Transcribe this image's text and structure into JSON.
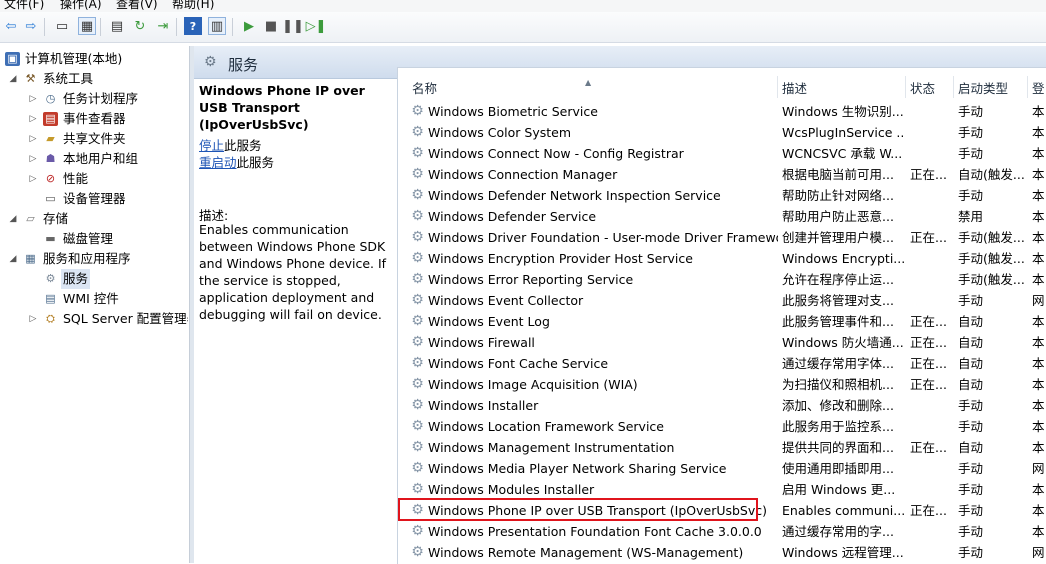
{
  "menu": [
    "文件(F)",
    "操作(A)",
    "查看(V)",
    "帮助(H)"
  ],
  "toolbar": [
    {
      "icon": "back-arrow-icon",
      "glyph": "⇦"
    },
    {
      "icon": "forward-arrow-icon",
      "glyph": "⇨"
    },
    {
      "icon": "up-folder-icon",
      "glyph": "▭"
    },
    {
      "icon": "show-hide-tree-icon",
      "glyph": "▦"
    },
    {
      "icon": "properties-icon",
      "glyph": "▤"
    },
    {
      "icon": "refresh-icon",
      "glyph": "↻"
    },
    {
      "icon": "export-list-icon",
      "glyph": "⇥"
    },
    {
      "icon": "help-icon",
      "glyph": "?"
    },
    {
      "icon": "show-action-pane-icon",
      "glyph": "▥"
    },
    {
      "icon": "start-service-icon",
      "glyph": "▶"
    },
    {
      "icon": "stop-service-icon",
      "glyph": "■"
    },
    {
      "icon": "pause-service-icon",
      "glyph": "❚❚"
    },
    {
      "icon": "restart-service-icon",
      "glyph": "▷❚"
    }
  ],
  "tree": [
    {
      "label": "计算机管理(本地)",
      "icon": "computer-management-icon",
      "glyph": "▣",
      "level": 0,
      "expander": "",
      "selected": false
    },
    {
      "label": "系统工具",
      "icon": "system-tools-icon",
      "glyph": "⚒",
      "level": 1,
      "expander": "◢",
      "selected": false
    },
    {
      "label": "任务计划程序",
      "icon": "task-scheduler-icon",
      "glyph": "◷",
      "level": 2,
      "expander": "▷",
      "selected": false
    },
    {
      "label": "事件查看器",
      "icon": "event-viewer-icon",
      "glyph": "▤",
      "level": 2,
      "expander": "▷",
      "selected": false
    },
    {
      "label": "共享文件夹",
      "icon": "shared-folders-icon",
      "glyph": "▰",
      "level": 2,
      "expander": "▷",
      "selected": false
    },
    {
      "label": "本地用户和组",
      "icon": "local-users-groups-icon",
      "glyph": "☗",
      "level": 2,
      "expander": "▷",
      "selected": false
    },
    {
      "label": "性能",
      "icon": "performance-icon",
      "glyph": "⊘",
      "level": 2,
      "expander": "▷",
      "selected": false
    },
    {
      "label": "设备管理器",
      "icon": "device-manager-icon",
      "glyph": "▭",
      "level": 2,
      "expander": "",
      "selected": false
    },
    {
      "label": "存储",
      "icon": "storage-icon",
      "glyph": "▱",
      "level": 1,
      "expander": "◢",
      "selected": false
    },
    {
      "label": "磁盘管理",
      "icon": "disk-management-icon",
      "glyph": "▬",
      "level": 2,
      "expander": "",
      "selected": false
    },
    {
      "label": "服务和应用程序",
      "icon": "services-applications-icon",
      "glyph": "▦",
      "level": 1,
      "expander": "◢",
      "selected": false
    },
    {
      "label": "服务",
      "icon": "services-gear-icon",
      "glyph": "⚙",
      "level": 2,
      "expander": "",
      "selected": true
    },
    {
      "label": "WMI 控件",
      "icon": "wmi-control-icon",
      "glyph": "▤",
      "level": 2,
      "expander": "",
      "selected": false
    },
    {
      "label": "SQL Server 配置管理器",
      "icon": "sql-server-config-icon",
      "glyph": "⛭",
      "level": 2,
      "expander": "▷",
      "selected": false
    }
  ],
  "header": {
    "title": "服务",
    "icon": "services-header-icon",
    "glyph": "⚙"
  },
  "description": {
    "title": "Windows Phone IP over USB Transport (IpOverUsbSvc)",
    "stop_link": "停止",
    "stop_suffix": "此服务",
    "restart_link": "重启动",
    "restart_suffix": "此服务",
    "desc_label": "描述:",
    "desc_text": "Enables communication between Windows Phone SDK and Windows Phone device. If the service is stopped, application deployment and debugging will fail on device."
  },
  "columns": [
    "名称",
    "描述",
    "状态",
    "启动类型",
    "登"
  ],
  "rows": [
    [
      "Windows Biometric Service",
      "Windows 生物识别...",
      "",
      "手动",
      "本"
    ],
    [
      "Windows Color System",
      "WcsPlugInService ...",
      "",
      "手动",
      "本"
    ],
    [
      "Windows Connect Now - Config Registrar",
      "WCNCSVC 承载 W...",
      "",
      "手动",
      "本"
    ],
    [
      "Windows Connection Manager",
      "根据电脑当前可用...",
      "正在...",
      "自动(触发...",
      "本"
    ],
    [
      "Windows Defender Network Inspection Service",
      "帮助防止针对网络...",
      "",
      "手动",
      "本"
    ],
    [
      "Windows Defender Service",
      "帮助用户防止恶意...",
      "",
      "禁用",
      "本"
    ],
    [
      "Windows Driver Foundation - User-mode Driver Framewo...",
      "创建并管理用户模...",
      "正在...",
      "手动(触发...",
      "本"
    ],
    [
      "Windows Encryption Provider Host Service",
      "Windows Encrypti...",
      "",
      "手动(触发...",
      "本"
    ],
    [
      "Windows Error Reporting Service",
      "允许在程序停止运...",
      "",
      "手动(触发...",
      "本"
    ],
    [
      "Windows Event Collector",
      "此服务将管理对支...",
      "",
      "手动",
      "网"
    ],
    [
      "Windows Event Log",
      "此服务管理事件和...",
      "正在...",
      "自动",
      "本"
    ],
    [
      "Windows Firewall",
      "Windows 防火墙通...",
      "正在...",
      "自动",
      "本"
    ],
    [
      "Windows Font Cache Service",
      "通过缓存常用字体...",
      "正在...",
      "自动",
      "本"
    ],
    [
      "Windows Image Acquisition (WIA)",
      "为扫描仪和照相机...",
      "正在...",
      "自动",
      "本"
    ],
    [
      "Windows Installer",
      "添加、修改和删除...",
      "",
      "手动",
      "本"
    ],
    [
      "Windows Location Framework Service",
      "此服务用于监控系...",
      "",
      "手动",
      "本"
    ],
    [
      "Windows Management Instrumentation",
      "提供共同的界面和...",
      "正在...",
      "自动",
      "本"
    ],
    [
      "Windows Media Player Network Sharing Service",
      "使用通用即插即用...",
      "",
      "手动",
      "网"
    ],
    [
      "Windows Modules Installer",
      "启用 Windows 更...",
      "",
      "手动",
      "本"
    ],
    [
      "Windows Phone IP over USB Transport (IpOverUsbSvc)",
      "Enables communi...",
      "正在...",
      "手动",
      "本"
    ],
    [
      "Windows Presentation Foundation Font Cache 3.0.0.0",
      "通过缓存常用的字...",
      "",
      "手动",
      "本"
    ],
    [
      "Windows Remote Management (WS-Management)",
      "Windows 远程管理...",
      "",
      "手动",
      "网"
    ]
  ],
  "colors": {
    "highlight_border": "#e0141c",
    "link": "#1d54b5",
    "header_bg": "#dbe5f1"
  }
}
